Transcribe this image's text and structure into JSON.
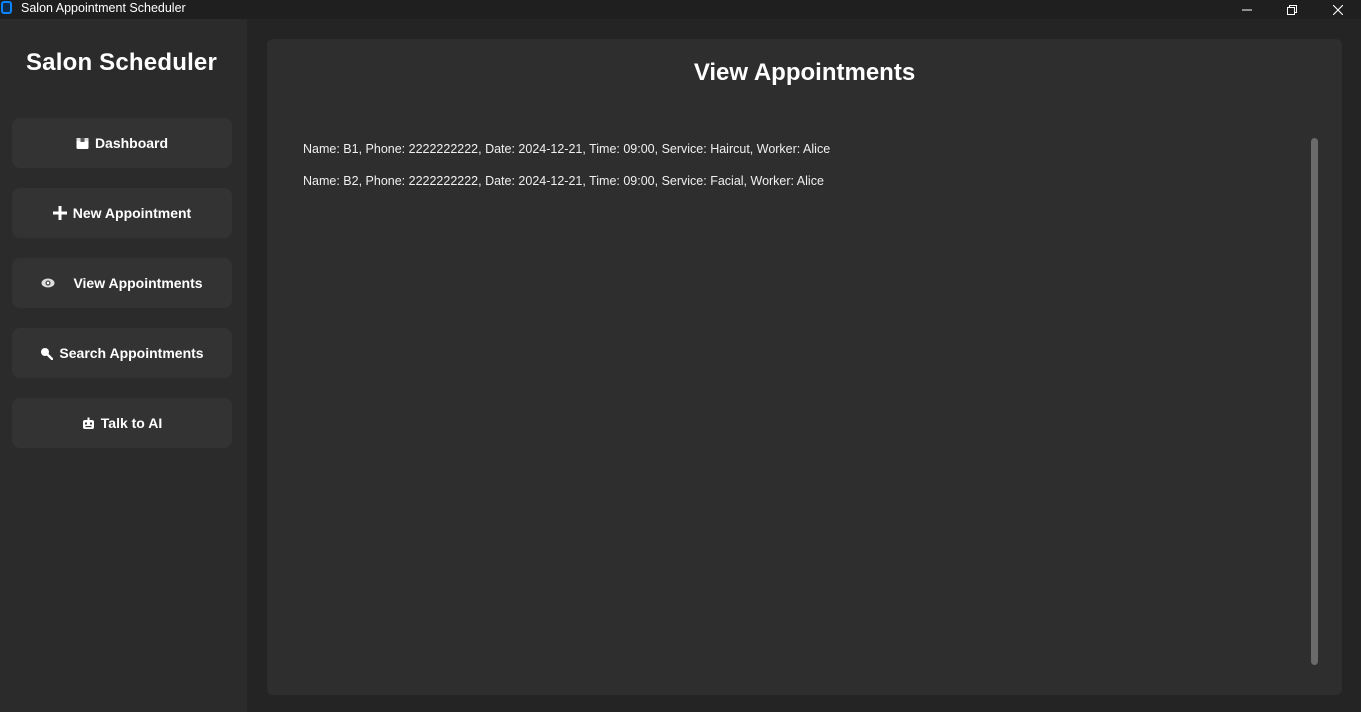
{
  "window": {
    "title": "Salon Appointment Scheduler",
    "controls": [
      "minimize",
      "restore",
      "close"
    ]
  },
  "sidebar": {
    "title": "Salon Scheduler",
    "items": [
      {
        "label": "Dashboard",
        "icon": "box-icon"
      },
      {
        "label": "New Appointment",
        "icon": "plus-icon"
      },
      {
        "label": "View Appointments",
        "icon": "eye-icon"
      },
      {
        "label": "Search Appointments",
        "icon": "magnifier-icon"
      },
      {
        "label": "Talk to AI",
        "icon": "robot-icon"
      }
    ]
  },
  "main": {
    "title": "View Appointments",
    "appointments": [
      "Name: B1, Phone: 2222222222, Date: 2024-12-21, Time: 09:00, Service: Haircut, Worker: Alice",
      "Name: B2, Phone: 2222222222, Date: 2024-12-21, Time: 09:00, Service: Facial, Worker: Alice"
    ]
  },
  "colors": {
    "background": "#242424",
    "sidebar": "#2b2b2b",
    "button": "#333333",
    "panel": "#2e2e2e",
    "accent": "#0a84ff"
  }
}
